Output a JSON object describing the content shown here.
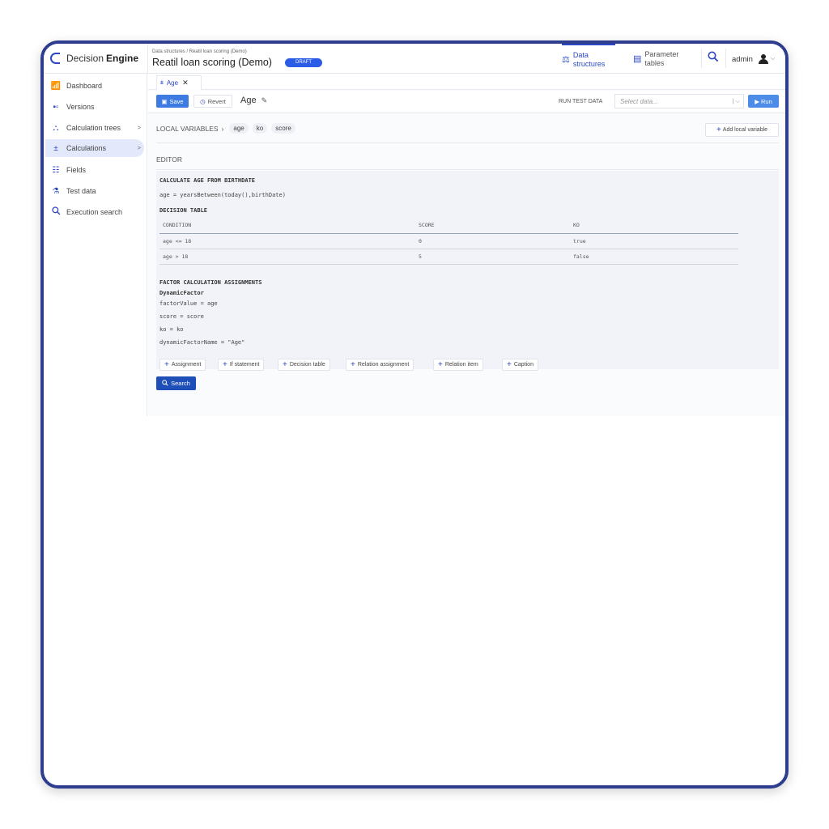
{
  "header": {
    "brand_light": "Decision",
    "brand_bold": "Engine",
    "breadcrumb": "Data structures / Reatil loan scoring (Demo)",
    "title": "Reatil loan scoring (Demo)",
    "status_badge": "DRAFT",
    "nav": [
      {
        "label": "Data structures",
        "icon": "data-structures-icon"
      },
      {
        "label": "Parameter tables",
        "icon": "table-icon"
      }
    ],
    "user": "admin"
  },
  "sidebar": {
    "items": [
      {
        "label": "Dashboard",
        "icon": "bar-chart-icon",
        "arrow": ""
      },
      {
        "label": "Versions",
        "icon": "versions-icon",
        "arrow": ""
      },
      {
        "label": "Calculation trees",
        "icon": "tree-icon",
        "arrow": ">"
      },
      {
        "label": "Calculations",
        "icon": "calculator-icon",
        "arrow": ">"
      },
      {
        "label": "Fields",
        "icon": "fields-icon",
        "arrow": ""
      },
      {
        "label": "Test data",
        "icon": "flask-icon",
        "arrow": ""
      },
      {
        "label": "Execution search",
        "icon": "search-icon",
        "arrow": ""
      }
    ],
    "active_index": 3
  },
  "tab": {
    "label": "Age"
  },
  "toolbar": {
    "save_label": "Save",
    "revert_label": "Revert",
    "calc_name": "Age",
    "run_test_label": "RUN TEST DATA",
    "select_placeholder": "Select data...",
    "run_label": "Run"
  },
  "local_variables": {
    "label": "LOCAL VARIABLES",
    "chips": [
      "age",
      "ko",
      "score"
    ],
    "add_label": "Add local variable"
  },
  "editor": {
    "label": "EDITOR",
    "section1_title": "CALCULATE AGE FROM BIRTHDATE",
    "section1_code": "age = yearsBetween(today(),birthDate)",
    "table_title": "DECISION TABLE",
    "table_headers": [
      "CONDITION",
      "SCORE",
      "KO"
    ],
    "table_rows": [
      [
        "age <= 18",
        "0",
        "true"
      ],
      [
        "age > 18",
        "5",
        "false"
      ]
    ],
    "factor_title": "FACTOR CALCULATION ASSIGNMENTS",
    "factor_name": "DynamicFactor",
    "factor_lines": [
      "factorValue = age",
      "score = score",
      "ko = ko",
      "dynamicFactorName = \"Age\""
    ],
    "add_buttons": [
      "Assignment",
      "If statement",
      "Decision table",
      "Relation assignment",
      "Relation item",
      "Caption"
    ]
  },
  "search_button": "Search",
  "colors": {
    "accent": "#2b47c4",
    "frame": "#2f3d8f",
    "draft": "#2b5ce6",
    "active_bg": "#e3e9fb"
  }
}
